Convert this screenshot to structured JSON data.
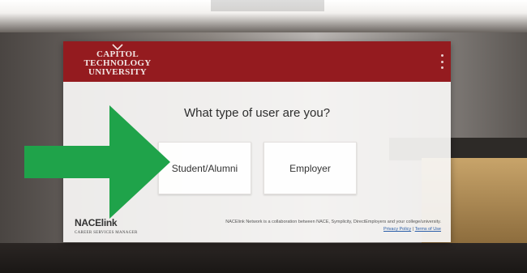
{
  "brand": {
    "logo_lines": [
      "CAPITOL",
      "TECHNOLOGY",
      "UNIVERSITY"
    ],
    "header_color": "#941b1f"
  },
  "prompt": {
    "question": "What type of user are you?"
  },
  "choices": [
    {
      "label": "Student/Alumni"
    },
    {
      "label": "Employer"
    }
  ],
  "footer": {
    "logo_text": "NACElink",
    "logo_subtext": "CAREER SERVICES MANAGER",
    "description": "NACElink Network is a collaboration between NACE, Symplicity, DirectEmployers and your college/university.",
    "privacy_label": "Privacy Policy",
    "separator": "|",
    "terms_label": "Terms of Use",
    "link_color": "#2a5ea8"
  },
  "annotation": {
    "arrow_color": "#1fa34a",
    "arrow_icon": "right-arrow-icon"
  }
}
